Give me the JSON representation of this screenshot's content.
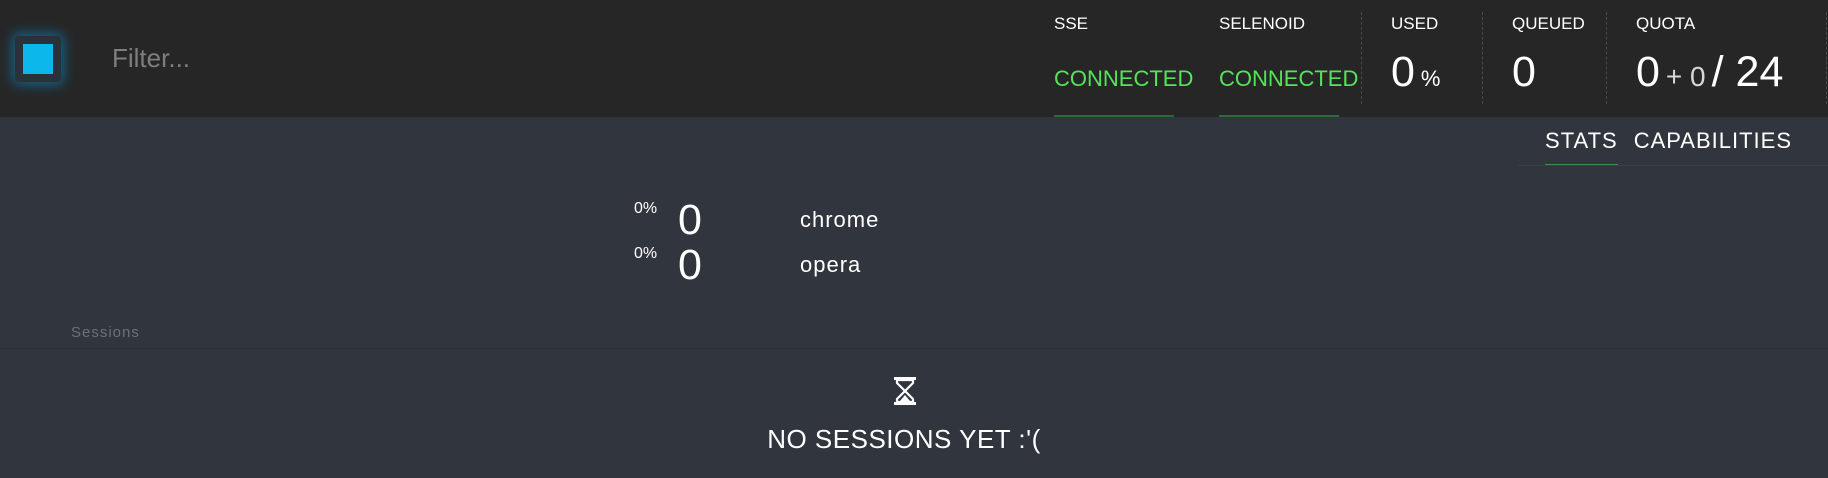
{
  "header": {
    "filter_placeholder": "Filter...",
    "sse": {
      "label": "SSE",
      "status": "CONNECTED"
    },
    "selenoid": {
      "label": "SELENOID",
      "status": "CONNECTED"
    },
    "used": {
      "label": "USED",
      "value": "0",
      "unit": "%"
    },
    "queued": {
      "label": "QUEUED",
      "value": "0"
    },
    "quota": {
      "label": "QUOTA",
      "used": "0",
      "extra": "+ 0",
      "separator": "/",
      "total": "24"
    }
  },
  "tabs": [
    {
      "label": "STATS",
      "active": true
    },
    {
      "label": "CAPABILITIES",
      "active": false
    }
  ],
  "browsers": [
    {
      "percent": "0%",
      "count": "0",
      "name": "chrome"
    },
    {
      "percent": "0%",
      "count": "0",
      "name": "opera"
    }
  ],
  "sessions": {
    "label": "Sessions",
    "empty_icon": "hourglass-icon",
    "empty_text": "NO SESSIONS YET :'("
  },
  "colors": {
    "topbar": "#262626",
    "page": "#31363e",
    "connected": "#55e35a",
    "logo": "#0cb7ec"
  }
}
